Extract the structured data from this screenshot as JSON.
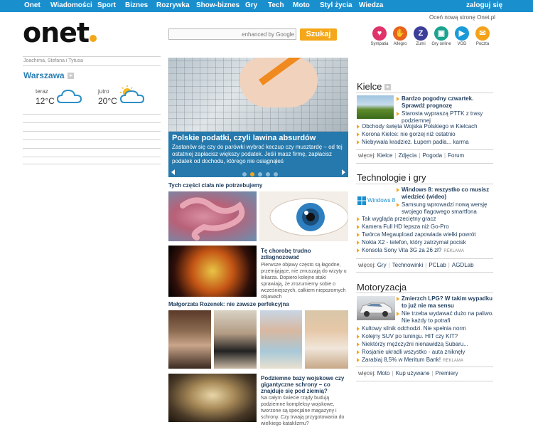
{
  "nav": {
    "items": [
      "Onet",
      "Wiadomości",
      "Sport",
      "Biznes",
      "Rozrywka",
      "Show-biznes",
      "Gry",
      "Tech",
      "Moto",
      "Styl życia",
      "Wiedza"
    ],
    "login": "zaloguj się"
  },
  "header": {
    "logo": "onet",
    "promo": "Oceń nową stronę Onet.pl",
    "search_placeholder": "enhanced by Google",
    "search_button": "Szukaj",
    "shortcuts": [
      {
        "label": "Sympatia",
        "icon": "heart-icon",
        "color": "#e0336a"
      },
      {
        "label": "Allegro",
        "icon": "hand-icon",
        "color": "#e8621d"
      },
      {
        "label": "Zumi",
        "icon": "z-icon",
        "color": "#3c3f98"
      },
      {
        "label": "Gry online",
        "icon": "joystick-icon",
        "color": "#1ba38f"
      },
      {
        "label": "VOD",
        "icon": "play-icon",
        "color": "#1a9bd8"
      },
      {
        "label": "Poczta",
        "icon": "envelope-icon",
        "color": "#f3a21a"
      }
    ]
  },
  "left": {
    "names": "Joachima, Stefana i Tytusa",
    "city": "Warszawa",
    "weather": [
      {
        "label": "teraz",
        "temp": "12°C",
        "icon": "cloud-icon"
      },
      {
        "label": "jutro",
        "temp": "20°C",
        "icon": "sun-cloud-icon"
      }
    ]
  },
  "hero": {
    "title": "Polskie podatki, czyli lawina absurdów",
    "text": "Zastanów się czy do parówki wybrać keczup czy musztardę – od tej ostatniej zapłacisz większy podatek. Jeśli masz firmę, zapłacisz podatek od dochodu, którego nie osiągnąłeś",
    "slide_count": 5,
    "active_slide": 2
  },
  "center": {
    "section1_title": "Tych części ciała nie potrzebujemy",
    "article1": {
      "title": "Tę chorobę trudno zdiagnozować",
      "text": "Pierwsze objawy często są łagodne, przemijające, nie zmuszają do wizyty u lekarza. Dopiero kolejne ataki sprawiają, że zrozumiemy sobie o wcześniejszych, całkiem niepozornych objawach"
    },
    "section2_title": "Małgorzata Rozenek: nie zawsze perfekcyjna",
    "article2": {
      "title": "Podziemne bazy wojskowe czy gigantyczne schrony – co znajduje się pod ziemią?",
      "text": "Na całym świecie rządy budują podziemne kompleksy wojskowe, tworzone są specjalne magazyny i schrony. Czy trwają przygotowania do wielkiego kataklizmu?"
    }
  },
  "right": {
    "kielce": {
      "title": "Kielce",
      "lead": "Bardzo pogodny czwartek. Sprawdź prognozę",
      "items": [
        "Starosta wypraszą PTTK z trasy podziemnej",
        "Obchody święta Wojska Polskiego w Kielcach",
        "Korona Kielce: nie gorzej niż ostatnio",
        "Niebywała kradzież. Łupem padła... karma"
      ],
      "more_label": "więcej:",
      "more": [
        "Kielce",
        "Zdjęcia",
        "Pogoda",
        "Forum"
      ]
    },
    "tech": {
      "title": "Technologie i gry",
      "badge": "Windows 8",
      "lead": "Windows 8: wszystko co musisz wiedzieć (wideo)",
      "lead2": "Samsung wprowadzi nową wersję swojego flagowego smartfona",
      "items": [
        "Tak wygląda przeciętny gracz",
        "Kamera Full HD lepsza niż Go-Pro",
        "Twórca Megaupload zapowiada wielki powrót",
        "Nokia X2 - telefon, który zatrzymał pocisk",
        "Konsola Sony Vita 3G za 26 zł?"
      ],
      "ad": "REKLAMA",
      "more_label": "więcej:",
      "more": [
        "Gry",
        "Technowinki",
        "PCLab",
        "AGDLab"
      ]
    },
    "moto": {
      "title": "Motoryzacja",
      "lead": "Zmierzch LPG? W takim wypadku to już nie ma sensu",
      "lead2": "Nie trzeba wydawać dużo na paliwo. Nie każdy to potrafi",
      "items": [
        "Kultowy silnik odchodzi. Nie spełnia norm",
        "Kolejny SUV po tuningu. HIT czy KIT?",
        "Niektórzy mężczyźni nienawidzą Subaru...",
        "Rosjanie ukradli wszystko - auta zniknęły",
        "Zarabiaj 8,5% w Meritum Bank!"
      ],
      "ad": "REKLAMA",
      "more_label": "więcej:",
      "more": [
        "Moto",
        "Kup używane",
        "Premiery"
      ]
    }
  },
  "colors": {
    "accent": "#1a8fce",
    "orange": "#f4a71a",
    "caption_bg": "#2579ac",
    "link": "#1e3c5c"
  }
}
